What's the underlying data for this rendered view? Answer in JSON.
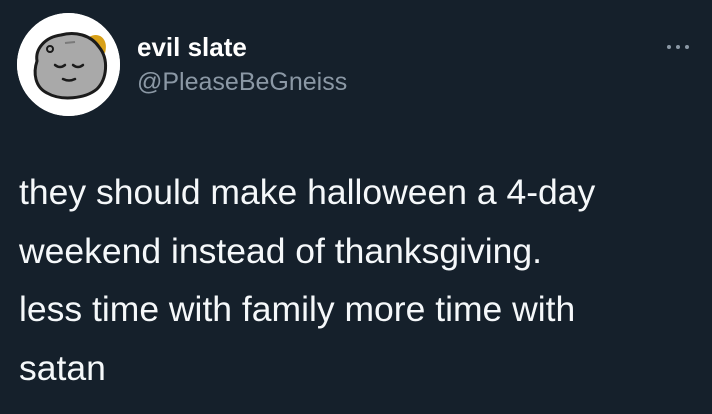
{
  "author": {
    "display_name": "evil slate",
    "handle": "@PleaseBeGneiss",
    "avatar_icon": "sleepy-rock-icon"
  },
  "menu": {
    "icon": "more-horizontal-icon"
  },
  "tweet": {
    "lines": [
      "they should make halloween a 4-day",
      "weekend instead of thanksgiving.",
      "less time with family more time with",
      "satan"
    ]
  },
  "colors": {
    "background": "#15202b",
    "text": "#f5f8fa",
    "secondary_text": "#8b98a5",
    "avatar_background": "#ffffff",
    "rock": "#a9a9a9",
    "outline": "#1b1b1b",
    "accent_gold": "#d8a018"
  }
}
